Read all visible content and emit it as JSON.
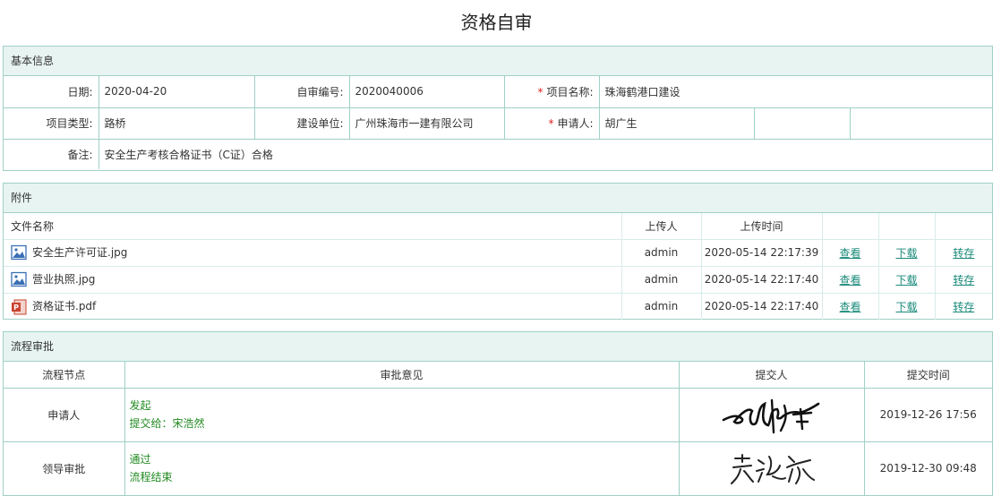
{
  "title": "资格自审",
  "basic": {
    "heading": "基本信息",
    "date_label": "日期:",
    "date": "2020-04-20",
    "code_label": "自审编号:",
    "code": "2020040006",
    "project_label": "项目名称:",
    "project": "珠海鹤港口建设",
    "type_label": "项目类型:",
    "type": "路桥",
    "builder_label": "建设单位:",
    "builder": "广州珠海市一建有限公司",
    "applicant_label": "申请人:",
    "applicant": "胡广生",
    "required_mark": "*",
    "remark_label": "备注:",
    "remark": "安全生产考核合格证书（C证）合格"
  },
  "attach": {
    "heading": "附件",
    "columns": {
      "name": "文件名称",
      "uploader": "上传人",
      "time": "上传时间"
    },
    "actions": {
      "view": "查看",
      "download": "下载",
      "save": "转存"
    },
    "files": [
      {
        "name": "安全生产许可证.jpg",
        "uploader": "admin",
        "time": "2020-05-14 22:17:39",
        "icon": "image-file-icon"
      },
      {
        "name": "营业执照.jpg",
        "uploader": "admin",
        "time": "2020-05-14 22:17:40",
        "icon": "image-file-icon"
      },
      {
        "name": "资格证书.pdf",
        "uploader": "admin",
        "time": "2020-05-14 22:17:40",
        "icon": "pdf-file-icon"
      }
    ]
  },
  "flow": {
    "heading": "流程审批",
    "columns": {
      "node": "流程节点",
      "opinion": "审批意见",
      "submitter": "提交人",
      "time": "提交时间"
    },
    "rows": [
      {
        "node": "申请人",
        "line1": "发起",
        "line2": "提交给：宋浩然",
        "time": "2019-12-26 17:56"
      },
      {
        "node": "领导审批",
        "line1": "通过",
        "line2": "流程结束",
        "time": "2019-12-30 09:48"
      }
    ]
  },
  "colors": {
    "border": "#9fd0c7",
    "header_bg": "#e8f4f2",
    "link": "#1a8a7a",
    "opinion": "#228b22",
    "required": "#e02020"
  }
}
